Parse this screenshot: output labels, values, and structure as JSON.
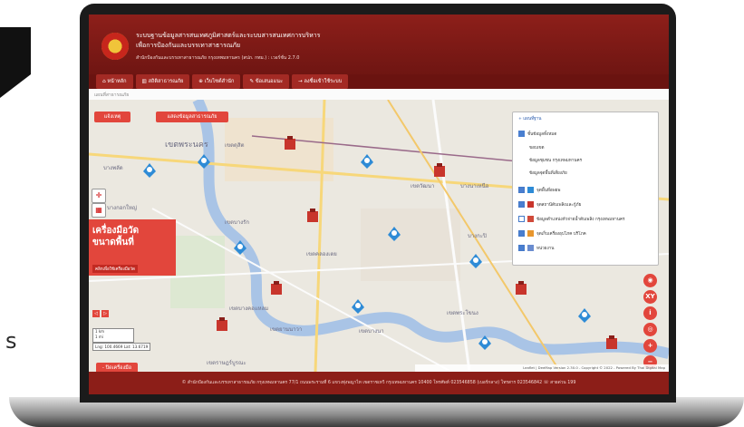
{
  "header": {
    "title_line1": "ระบบฐานข้อมูลสารสนเทศภูมิศาสตร์และระบบสารสนเทศการบริหาร",
    "title_line2": "เพื่อการป้องกันและบรรเทาสาธารณภัย",
    "subtitle": "สำนักป้องกันและบรรเทาสาธารณภัย กรุงเทพมหานคร (สปภ. กทม.) : เวอร์ชั่น 2.7.0"
  },
  "nav": {
    "items": [
      {
        "label": "หน้าหลัก",
        "icon": "home-icon"
      },
      {
        "label": "สถิติสาธารณภัย",
        "icon": "chart-icon"
      },
      {
        "label": "เว็บไซต์สำนัก",
        "icon": "globe-icon"
      },
      {
        "label": "ข้อเสนอแนะ",
        "icon": "comment-icon"
      },
      {
        "label": "ลงชื่อเข้าใช้ระบบ",
        "icon": "login-icon"
      }
    ]
  },
  "breadcrumb": "แผนที่สาธารณภัย",
  "map": {
    "report_button": "แจ้งเหตุ",
    "show_data_button": "แสดงข้อมูลสาธารณภัย",
    "places": [
      "เขตพระนคร",
      "บางซื่อ",
      "เขตดุสิต",
      "เขตบางรัก",
      "เขตคลองเตย",
      "เขตบางคอแหลม",
      "เขตยานนาวา",
      "บางพลัด",
      "บางกอกใหญ่",
      "เขตจตุจักร",
      "เขตวัฒนา",
      "เขตบางนา",
      "บางกะปิ",
      "เขตพระโขนง",
      "เขตราษฎร์บูรณะ",
      "ตลิ่งชัน",
      "บางนาเหนือ"
    ],
    "tool_panel": {
      "title_line1": "เครื่องมือวัด",
      "title_line2": "ขนาดพื้นที่",
      "hint": "คลิกเพื่อใช้เครื่องมือวัด"
    },
    "scale": {
      "line1": "1 km",
      "line2": "1 mi"
    },
    "coords": "Lng: 100.4669 Lat: 13.6719",
    "close_tool": "- ปิดเครื่องมือ",
    "attribution": "Leaflet | DeeMap Version 2.30.0 - Copyright © 2022 - Powered By Thai Digital Map",
    "right_buttons": [
      "XY",
      "i",
      "+",
      "−"
    ]
  },
  "legend": {
    "header": "+ แผนที่ฐาน",
    "group": "ชั้นข้อมูลทั้งหมด",
    "items": [
      {
        "label": "ขอบเขต",
        "checked": false
      },
      {
        "label": "ข้อมูลชุมชน กรุงเทพมหานคร",
        "checked": false
      },
      {
        "label": "ข้อมูลจุดพื้นที่เสี่ยงภัย",
        "checked": false
      },
      {
        "label": "จุดพื้นที่อพยพ",
        "checked": true
      },
      {
        "label": "จุดสถานีดับเพลิงและกู้ภัย",
        "checked": true
      },
      {
        "label": "ข้อมูลตำแหน่งหัวจ่ายน้ำดับเพลิง กรุงเทพมหานคร",
        "checked": false
      },
      {
        "label": "จุดเก็บเครื่องอุปโภค บริโภค",
        "checked": true
      },
      {
        "label": "หน่วยงาน",
        "checked": true
      }
    ]
  },
  "footer": "© สำนักป้องกันและบรรเทาสาธารณภัย กรุงเทพมหานคร 77/1 ถนนพระรามที่ 6 แขวงทุ่งพญาไท เขตราชเทวี กรุงเทพมหานคร 10400 โทรศัพท์ 023546858 (เบอร์กลาง) โทรสาร 023546842 ☏ สายด่วน 199",
  "colors": {
    "brand": "#7d1a16",
    "accent": "#e2463c",
    "map_bg": "#e9e6dd",
    "river": "#a9c4e6"
  }
}
